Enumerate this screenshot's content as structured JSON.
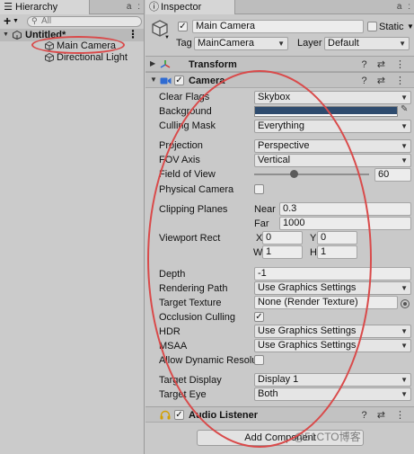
{
  "hierarchy": {
    "tab_label": "Hierarchy",
    "tab_tools": "a :",
    "add_glyph": "+",
    "search": {
      "placeholder": "All"
    },
    "scene": {
      "name": "Untitled*"
    },
    "items": [
      {
        "label": "Main Camera"
      },
      {
        "label": "Directional Light"
      }
    ]
  },
  "inspector": {
    "tab_label": "Inspector",
    "tab_tools": "a :",
    "object_name": "Main Camera",
    "static_label": "Static",
    "tag_label": "Tag",
    "tag_value": "MainCamera",
    "layer_label": "Layer",
    "layer_value": "Default",
    "components": {
      "transform": "Transform",
      "camera": "Camera",
      "audio_listener": "Audio Listener"
    },
    "header_tools": "? ⇄ ⋮",
    "camera_props": {
      "clear_flags": {
        "label": "Clear Flags",
        "value": "Skybox"
      },
      "background": {
        "label": "Background"
      },
      "culling_mask": {
        "label": "Culling Mask",
        "value": "Everything"
      },
      "projection": {
        "label": "Projection",
        "value": "Perspective"
      },
      "fov_axis": {
        "label": "FOV Axis",
        "value": "Vertical"
      },
      "field_of_view": {
        "label": "Field of View",
        "value": "60"
      },
      "physical_camera": {
        "label": "Physical Camera"
      },
      "clipping_planes": {
        "label": "Clipping Planes",
        "near_label": "Near",
        "near": "0.3",
        "far_label": "Far",
        "far": "1000"
      },
      "viewport_rect": {
        "label": "Viewport Rect",
        "x_label": "X",
        "x": "0",
        "y_label": "Y",
        "y": "0",
        "w_label": "W",
        "w": "1",
        "h_label": "H",
        "h": "1"
      },
      "depth": {
        "label": "Depth",
        "value": "-1"
      },
      "rendering_path": {
        "label": "Rendering Path",
        "value": "Use Graphics Settings"
      },
      "target_texture": {
        "label": "Target Texture",
        "value": "None (Render Texture)"
      },
      "occlusion_culling": {
        "label": "Occlusion Culling"
      },
      "hdr": {
        "label": "HDR",
        "value": "Use Graphics Settings"
      },
      "msaa": {
        "label": "MSAA",
        "value": "Use Graphics Settings"
      },
      "dynamic_resolution": {
        "label": "Allow Dynamic Resolut"
      },
      "target_display": {
        "label": "Target Display",
        "value": "Display 1"
      },
      "target_eye": {
        "label": "Target Eye",
        "value": "Both"
      }
    },
    "add_component": "Add Component"
  },
  "watermark": "@51CTO博客",
  "colors": {
    "background_swatch": "#2e4b6e",
    "annotation_red": "#d94a4a"
  }
}
